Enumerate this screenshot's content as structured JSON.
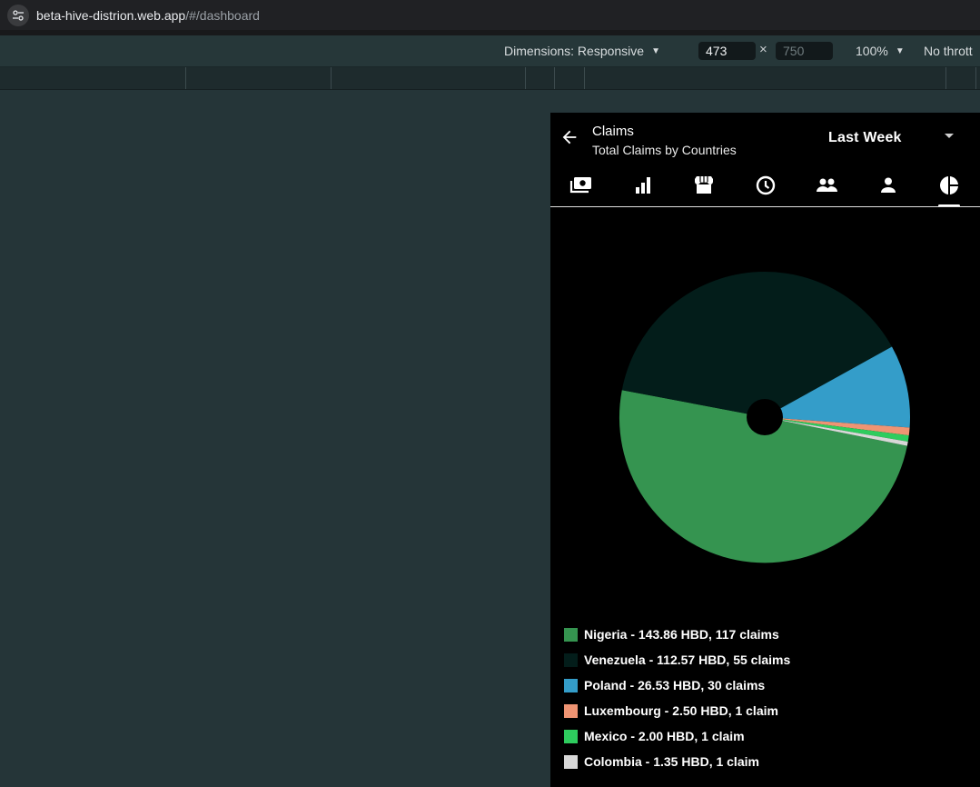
{
  "browser": {
    "url_host": "beta-hive-distrion.web.app",
    "url_path": "/#/dashboard"
  },
  "device_toolbar": {
    "dimensions_label": "Dimensions: Responsive",
    "width": "473",
    "height": "750",
    "times": "×",
    "zoom": "100%",
    "throttle": "No thrott"
  },
  "app": {
    "title": "Claims",
    "subtitle": "Total Claims by Countries",
    "range": "Last Week",
    "tabs": [
      {
        "icon": "payments-icon",
        "active": false
      },
      {
        "icon": "bar-chart-icon",
        "active": false
      },
      {
        "icon": "store-icon",
        "active": false
      },
      {
        "icon": "clock-icon",
        "active": false
      },
      {
        "icon": "group-icon",
        "active": false
      },
      {
        "icon": "person-icon",
        "active": false
      },
      {
        "icon": "pie-chart-icon",
        "active": true
      }
    ]
  },
  "chart_data": {
    "type": "pie",
    "categories": [
      "Nigeria",
      "Venezuela",
      "Poland",
      "Luxembourg",
      "Mexico",
      "Colombia"
    ],
    "values": [
      143.86,
      112.57,
      26.53,
      2.5,
      2.0,
      1.35
    ],
    "colors": [
      "#359450",
      "#031d1a",
      "#349dc9",
      "#ef9473",
      "#2ecc5e",
      "#d8d8d8"
    ],
    "legend": [
      "Nigeria - 143.86 HBD, 117 claims",
      "Venezuela - 112.57 HBD, 55 claims",
      "Poland - 26.53 HBD, 30 claims",
      "Luxembourg - 2.50 HBD, 1 claim",
      "Mexico - 2.00 HBD, 1 claim",
      "Colombia - 1.35 HBD, 1 claim"
    ],
    "legend_placement": "bottom"
  }
}
